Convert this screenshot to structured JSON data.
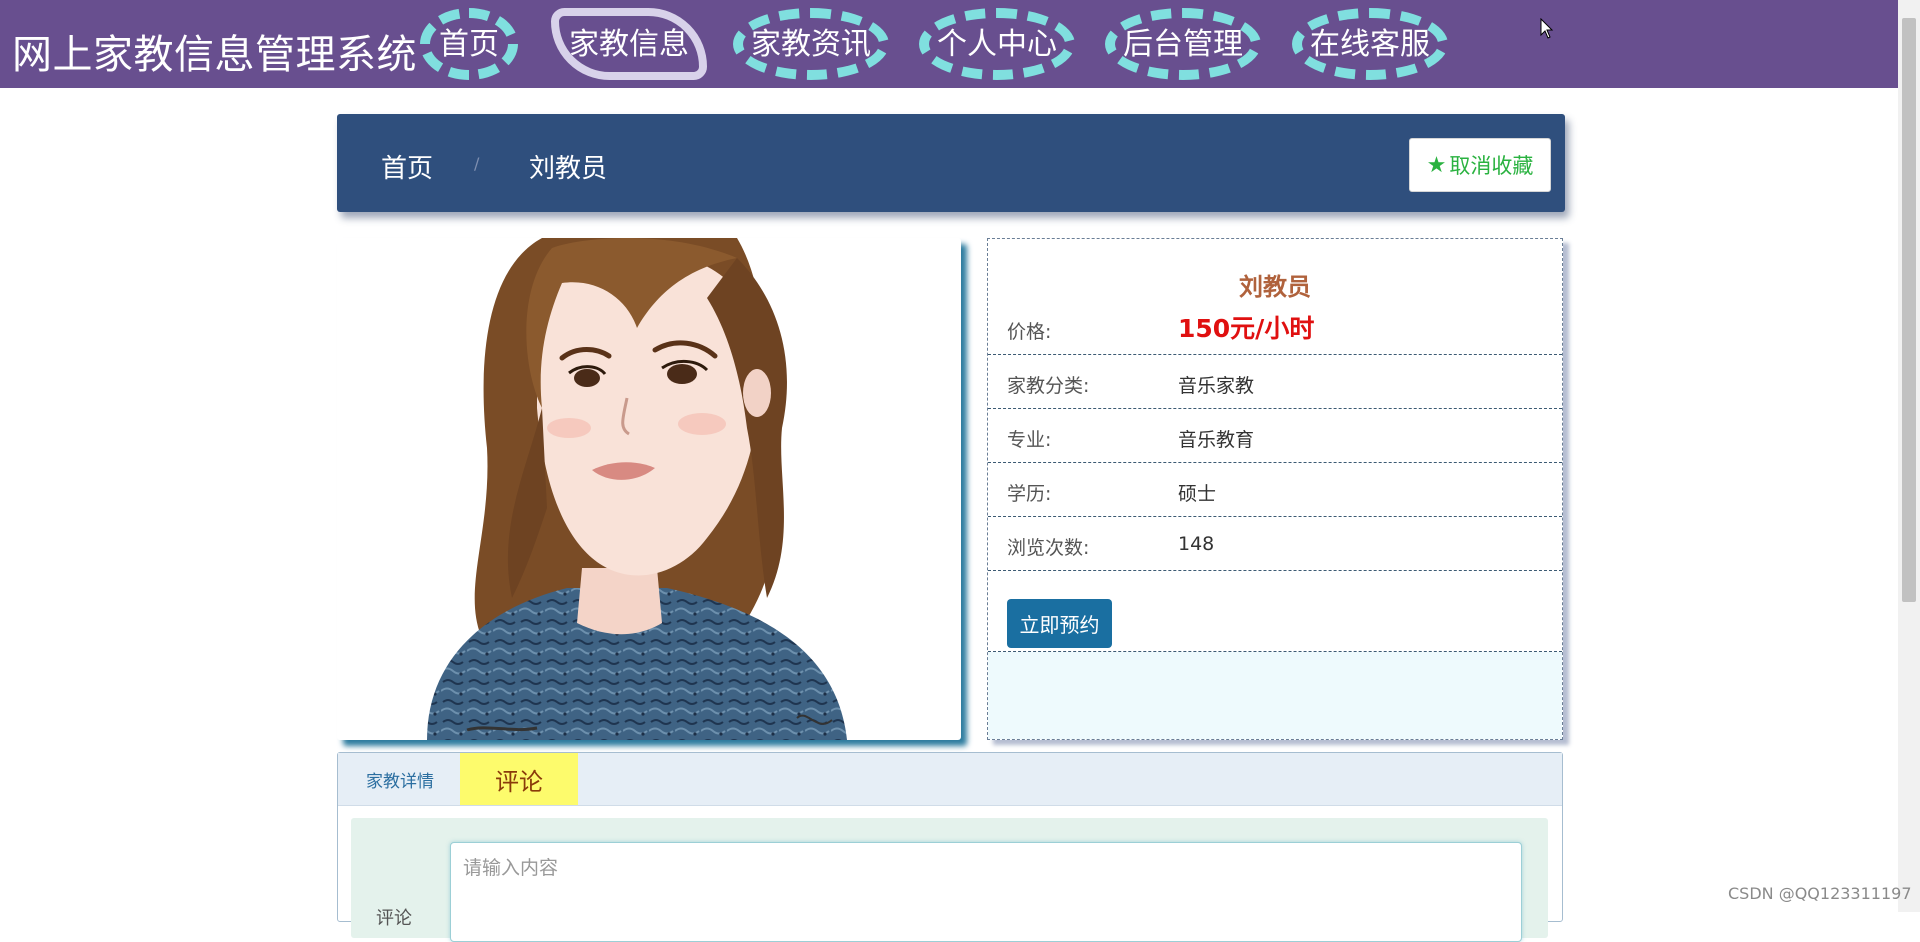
{
  "app": {
    "title": "网上家教信息管理系统"
  },
  "nav": {
    "items": [
      {
        "label": "首页",
        "active": false
      },
      {
        "label": "家教信息",
        "active": true
      },
      {
        "label": "家教资讯",
        "active": false
      },
      {
        "label": "个人中心",
        "active": false
      },
      {
        "label": "后台管理",
        "active": false
      },
      {
        "label": "在线客服",
        "active": false
      }
    ]
  },
  "breadcrumb": {
    "home": "首页",
    "current": "刘教员",
    "separator": "/"
  },
  "favorite": {
    "label": "取消收藏",
    "icon": "star-icon"
  },
  "tutor": {
    "name": "刘教员",
    "rows": [
      {
        "label": "价格:",
        "value": "150元/小时"
      },
      {
        "label": "家教分类:",
        "value": "音乐家教"
      },
      {
        "label": "专业:",
        "value": "音乐教育"
      },
      {
        "label": "学历:",
        "value": "硕士"
      },
      {
        "label": "浏览次数:",
        "value": "148"
      }
    ],
    "book_label": "立即预约"
  },
  "tabs": [
    {
      "label": "家教详情",
      "active": false
    },
    {
      "label": "评论",
      "active": true
    }
  ],
  "comment": {
    "label": "评论",
    "placeholder": "请输入内容"
  },
  "watermark": "CSDN @QQ123311197",
  "colors": {
    "topbar": "#684f8f",
    "nav_dash": "#80dfdf",
    "breadcrumb_bar": "#2f4f7d",
    "favorite_text": "#2ab240",
    "price": "#e01010",
    "name": "#b0623c",
    "book_button": "#1a6fa1",
    "active_tab": "#fdfb6c"
  }
}
